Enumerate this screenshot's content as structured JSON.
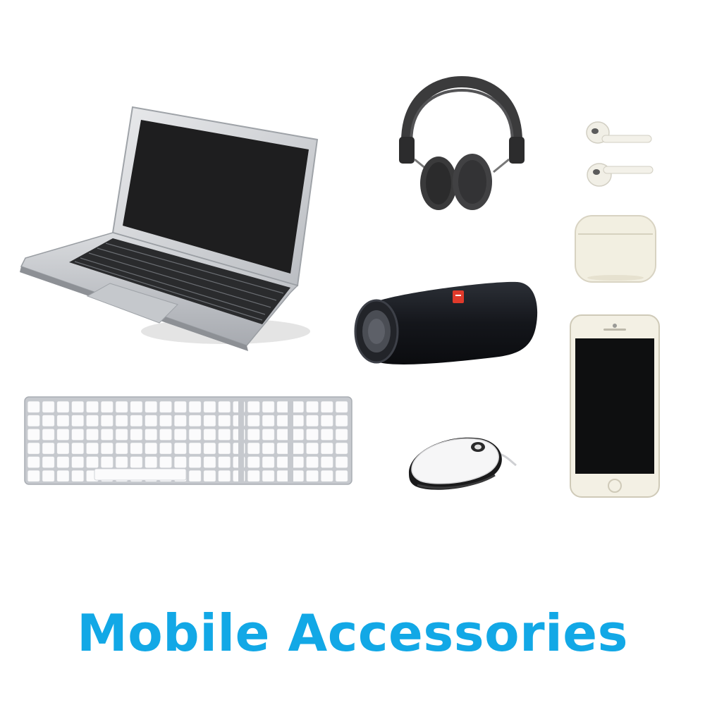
{
  "page": {
    "background": "#ffffff",
    "title": "Mobile Accessories",
    "title_color": "#12a8e6"
  },
  "products": [
    {
      "name": "laptop",
      "icon": "laptop-icon"
    },
    {
      "name": "headphones",
      "icon": "headphones-icon"
    },
    {
      "name": "earbuds",
      "icon": "earbuds-icon"
    },
    {
      "name": "earbuds case",
      "icon": "earbuds-case-icon"
    },
    {
      "name": "bluetooth speaker",
      "icon": "speaker-icon"
    },
    {
      "name": "smartphone",
      "icon": "smartphone-icon"
    },
    {
      "name": "keyboard",
      "icon": "keyboard-icon"
    },
    {
      "name": "mouse",
      "icon": "mouse-icon"
    }
  ]
}
